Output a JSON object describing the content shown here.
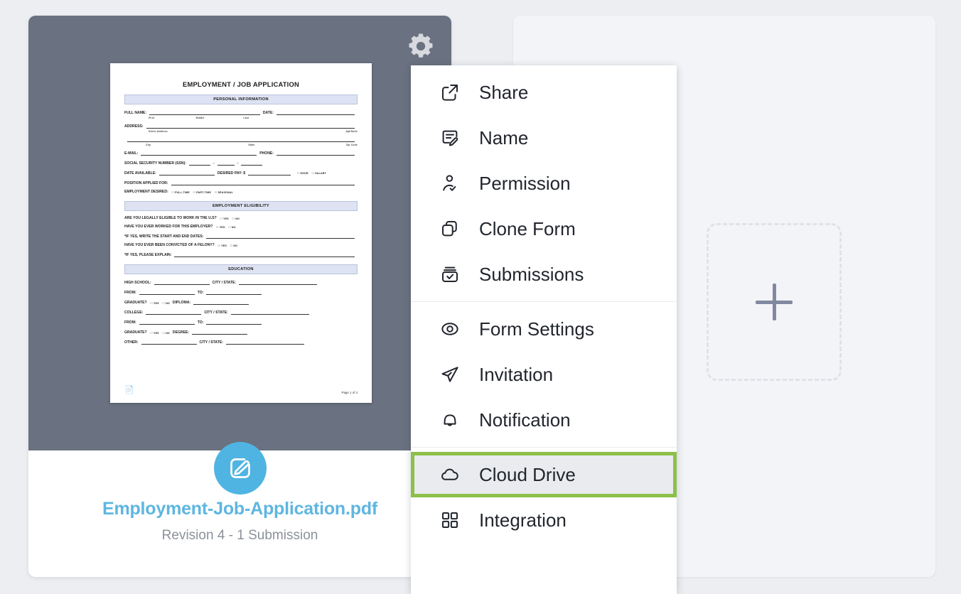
{
  "card": {
    "gear_icon": "gear-icon",
    "edit_badge_icon": "edit-pencil-icon",
    "file_name": "Employment-Job-Application.pdf",
    "meta": "Revision 4 - 1 Submission",
    "accent_color": "#5eb6e0",
    "thumb_bg": "#6a7180"
  },
  "right_card": {
    "add_icon": "plus-icon"
  },
  "menu": {
    "groups": [
      {
        "items": [
          {
            "label": "Share",
            "icon": "share-external-icon"
          },
          {
            "label": "Name",
            "icon": "rename-edit-icon"
          },
          {
            "label": "Permission",
            "icon": "user-check-icon"
          },
          {
            "label": "Clone Form",
            "icon": "copy-duplicate-icon"
          },
          {
            "label": "Submissions",
            "icon": "inbox-check-icon"
          }
        ]
      },
      {
        "items": [
          {
            "label": "Form Settings",
            "icon": "target-eye-icon"
          },
          {
            "label": "Invitation",
            "icon": "paper-plane-icon"
          },
          {
            "label": "Notification",
            "icon": "bell-icon"
          }
        ]
      },
      {
        "items": [
          {
            "label": "Cloud Drive",
            "icon": "cloud-icon",
            "highlighted": true
          },
          {
            "label": "Integration",
            "icon": "grid-squares-icon"
          }
        ]
      }
    ],
    "highlight_color": "#8cc04a",
    "highlight_bg": "#e9ebef"
  },
  "document": {
    "title": "EMPLOYMENT / JOB APPLICATION",
    "section_personal": "PERSONAL INFORMATION",
    "section_eligibility": "EMPLOYMENT ELIGIBILITY",
    "section_education": "EDUCATION",
    "labels": {
      "full_name": "FULL NAME:",
      "date": "DATE:",
      "first": "First",
      "middle": "Middle",
      "last": "Last",
      "address": "ADDRESS:",
      "street_address": "Street Address",
      "apt_suite": "Apt/Suite",
      "city": "City",
      "state": "State",
      "zip_code": "Zip Code",
      "email": "E-MAIL:",
      "phone": "PHONE:",
      "ssn": "SOCIAL SECURITY NUMBER (SSN):",
      "date_available": "DATE AVAILABLE:",
      "desired_pay": "DESIRED PAY: $",
      "hour": "HOUR",
      "salary": "SALARY",
      "position_applied": "POSITION APPLIED FOR:",
      "employment_desired": "EMPLOYMENT DESIRED:",
      "full_time": "FULL-TIME",
      "part_time": "PART-TIME",
      "seasonal": "SEASONAL",
      "legally_eligible": "ARE YOU LEGALLY ELIGIBLE TO WORK IN THE U.S?",
      "worked_before": "HAVE YOU EVER WORKED FOR THIS EMPLOYER?",
      "start_end_dates": "*IF YES, WRITE THE START AND END DATES:",
      "felony": "HAVE YOU EVER BEEN CONVICTED OF A FELONY?",
      "explain": "*IF YES, PLEASE EXPLAIN:",
      "yes": "YES",
      "no": "NO",
      "high_school": "HIGH SCHOOL:",
      "city_state": "CITY / STATE:",
      "from": "FROM:",
      "to": "TO:",
      "graduate": "GRADUATE?",
      "diploma": "DIPLOMA:",
      "college": "COLLEGE:",
      "degree": "DEGREE:",
      "other": "OTHER:"
    },
    "page_footer": "Page 1 of 4"
  }
}
